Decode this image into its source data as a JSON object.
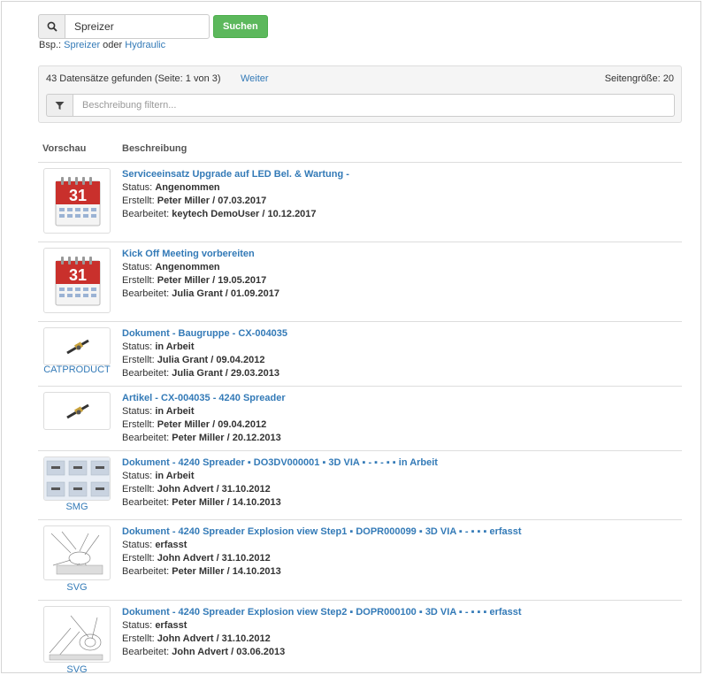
{
  "search": {
    "value": "Spreizer",
    "button": "Suchen",
    "examples_prefix": "Bsp.:",
    "example_1": "Spreizer",
    "example_joiner": "oder",
    "example_2": "Hydraulic"
  },
  "results": {
    "info": "43 Datensätze gefunden (Seite: 1 von 3)",
    "next": "Weiter",
    "page_size": "Seitengröße: 20",
    "filter_placeholder": "Beschreibung filtern..."
  },
  "table": {
    "col_preview": "Vorschau",
    "col_description": "Beschreibung"
  },
  "labels": {
    "status": "Status:",
    "created": "Erstellt:",
    "edited": "Bearbeitet:"
  },
  "rows": [
    {
      "thumb": "calendar-icon",
      "title": "Serviceeinsatz Upgrade auf LED Bel. & Wartung -",
      "status": "Angenommen",
      "created": "Peter Miller / 07.03.2017",
      "edited": "keytech DemoUser / 10.12.2017"
    },
    {
      "thumb": "calendar-icon",
      "title": "Kick Off Meeting vorbereiten",
      "status": "Angenommen",
      "created": "Peter Miller / 19.05.2017",
      "edited": "Julia Grant / 01.09.2017"
    },
    {
      "thumb": "spreader-part-icon",
      "thumb_label": "CATPRODUCT",
      "title": "Dokument - Baugruppe - CX-004035",
      "status": "in Arbeit",
      "created": "Julia Grant / 09.04.2012",
      "edited": "Julia Grant / 29.03.2013"
    },
    {
      "thumb": "spreader-part-icon",
      "title": "Artikel - CX-004035 - 4240 Spreader",
      "status": "in Arbeit",
      "created": "Peter Miller / 09.04.2012",
      "edited": "Peter Miller / 20.12.2013"
    },
    {
      "thumb": "parts-sheet-thumbnail",
      "thumb_label": "SMG",
      "title": "Dokument - 4240 Spreader ▪ DO3DV000001 ▪ 3D VIA ▪ - ▪ - ▪ ▪ in Arbeit",
      "status": "in Arbeit",
      "created": "John Advert / 31.10.2012",
      "edited": "Peter Miller / 14.10.2013"
    },
    {
      "thumb": "explosion-drawing-thumbnail",
      "thumb_label": "SVG",
      "title": "Dokument - 4240 Spreader Explosion view Step1 ▪ DOPR000099 ▪ 3D VIA ▪ - ▪ ▪ ▪ erfasst",
      "status": "erfasst",
      "created": "John Advert / 31.10.2012",
      "edited": "Peter Miller / 14.10.2013"
    },
    {
      "thumb": "explosion-drawing-thumbnail",
      "thumb_label": "SVG",
      "title": "Dokument - 4240 Spreader Explosion view Step2 ▪ DOPR000100 ▪ 3D VIA ▪ - ▪ ▪ ▪ erfasst",
      "status": "erfasst",
      "created": "John Advert / 31.10.2012",
      "edited": "John Advert / 03.06.2013"
    }
  ],
  "calendar_day": "31",
  "colors": {
    "link": "#337ab7",
    "success": "#5cb85c",
    "calendar_red": "#c9302c"
  }
}
